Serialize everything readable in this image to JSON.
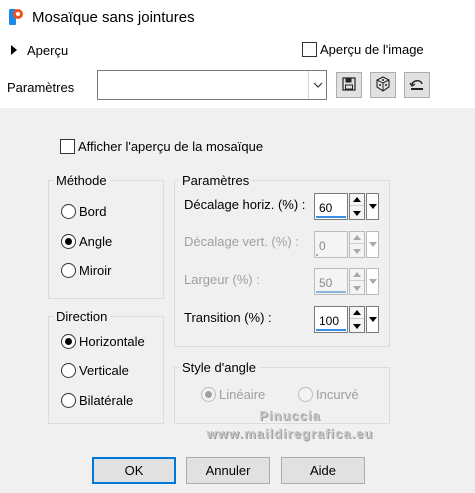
{
  "window": {
    "title": "Mosaïque sans jointures",
    "icon": "paintshop-pro-icon"
  },
  "preview_bar": {
    "apercu_label": "Aperçu",
    "apercu_image_label": "Aperçu de l'image",
    "apercu_image_checked": false
  },
  "presets": {
    "label": "Paramètres",
    "value": "",
    "buttons": [
      "save-icon",
      "random-dice-icon",
      "reset-icon"
    ]
  },
  "show_preview": {
    "label": "Afficher l'aperçu de la mosaïque",
    "checked": false
  },
  "methode": {
    "title": "Méthode",
    "options": [
      "Bord",
      "Angle",
      "Miroir"
    ],
    "selected": "Angle"
  },
  "direction": {
    "title": "Direction",
    "options": [
      "Horizontale",
      "Verticale",
      "Bilatérale"
    ],
    "selected": "Horizontale"
  },
  "parametres": {
    "title": "Paramètres",
    "rows": [
      {
        "label": "Décalage horiz. (%) :",
        "value": "60",
        "enabled": true
      },
      {
        "label": "Décalage vert. (%) :",
        "value": "0",
        "enabled": false
      },
      {
        "label": "Largeur (%) :",
        "value": "50",
        "enabled": false
      },
      {
        "label": "Transition (%) :",
        "value": "100",
        "enabled": true
      }
    ]
  },
  "style_angle": {
    "title": "Style d'angle",
    "options": [
      "Linéaire",
      "Incurvé"
    ],
    "selected": "Linéaire",
    "enabled": false
  },
  "watermark": {
    "line1": "Pinuccia",
    "line2": "www.maildiregrafica.eu"
  },
  "buttons": {
    "ok": "OK",
    "cancel": "Annuler",
    "help": "Aide"
  },
  "colors": {
    "accent": "#0078d7",
    "panel": "#f0f0f0",
    "spin_bar": "#3a8ee6"
  }
}
